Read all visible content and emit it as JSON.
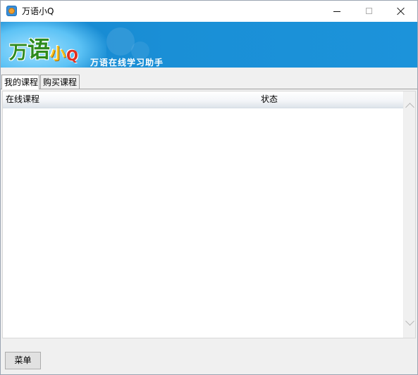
{
  "window": {
    "title": "万语小Q",
    "controls": [
      "minimize",
      "maximize",
      "close"
    ]
  },
  "banner": {
    "logo_chars": [
      "万",
      "语",
      "小",
      "Q"
    ],
    "slogan": "万语在线学习助手",
    "colors": {
      "background": "#1c93da",
      "logo_green": "#2e8b1e",
      "logo_yellow": "#f7c21a",
      "logo_red": "#e03020"
    }
  },
  "tabs": [
    {
      "label": "我的课程",
      "active": true
    },
    {
      "label": "购买课程",
      "active": false
    }
  ],
  "list": {
    "columns": [
      "在线课程",
      "状态"
    ],
    "rows": []
  },
  "footer": {
    "menu_label": "菜单"
  }
}
